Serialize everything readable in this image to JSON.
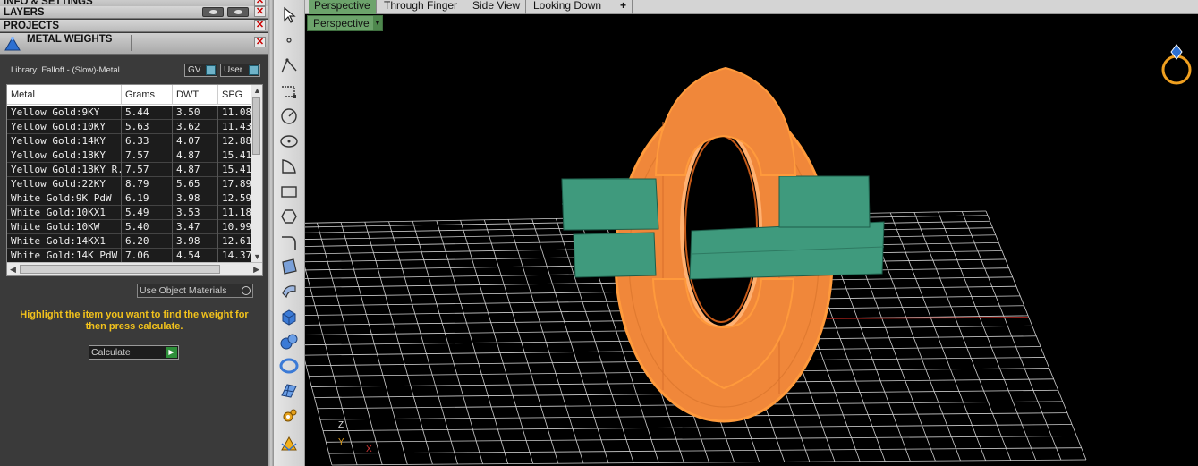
{
  "panels": {
    "info_settings": "INFO & SETTINGS",
    "layers": "LAYERS",
    "projects": "PROJECTS",
    "metal_weights": "METAL WEIGHTS"
  },
  "library_label": "Library: Falloff - (Slow)-Metal",
  "filters": {
    "gv": "GV",
    "user": "User"
  },
  "table": {
    "headers": [
      "Metal",
      "Grams",
      "DWT",
      "SPG"
    ],
    "rows": [
      [
        "Yellow Gold:9KY",
        "5.44",
        "3.50",
        "11.08"
      ],
      [
        "Yellow Gold:10KY",
        "5.63",
        "3.62",
        "11.43"
      ],
      [
        "Yellow Gold:14KY",
        "6.33",
        "4.07",
        "12.88"
      ],
      [
        "Yellow Gold:18KY",
        "7.57",
        "4.87",
        "15.41"
      ],
      [
        "Yellow Gold:18KY R...",
        "7.57",
        "4.87",
        "15.41"
      ],
      [
        "Yellow Gold:22KY",
        "8.79",
        "5.65",
        "17.89"
      ],
      [
        "White Gold:9K PdW",
        "6.19",
        "3.98",
        "12.59"
      ],
      [
        "White Gold:10KX1",
        "5.49",
        "3.53",
        "11.18"
      ],
      [
        "White Gold:10KW",
        "5.40",
        "3.47",
        "10.99"
      ],
      [
        "White Gold:14KX1",
        "6.20",
        "3.98",
        "12.61"
      ],
      [
        "White Gold:14K PdW",
        "7.06",
        "4.54",
        "14.37"
      ]
    ]
  },
  "use_object_materials": "Use Object Materials",
  "hint": "Highlight the item you want to find the weight for then press calculate.",
  "calculate_label": "Calculate",
  "view_tabs": [
    "Perspective",
    "Through Finger",
    "Side View",
    "Looking Down"
  ],
  "view_add_icon": "plus-icon",
  "viewport_label": "Perspective",
  "axes": {
    "z": "Z",
    "y": "Y",
    "x": "X"
  },
  "colors": {
    "ring_orange": "#f0873a",
    "band_green": "#3f9a7d",
    "hint_yellow": "#f2c21c",
    "active_tab": "#6ca36b"
  }
}
